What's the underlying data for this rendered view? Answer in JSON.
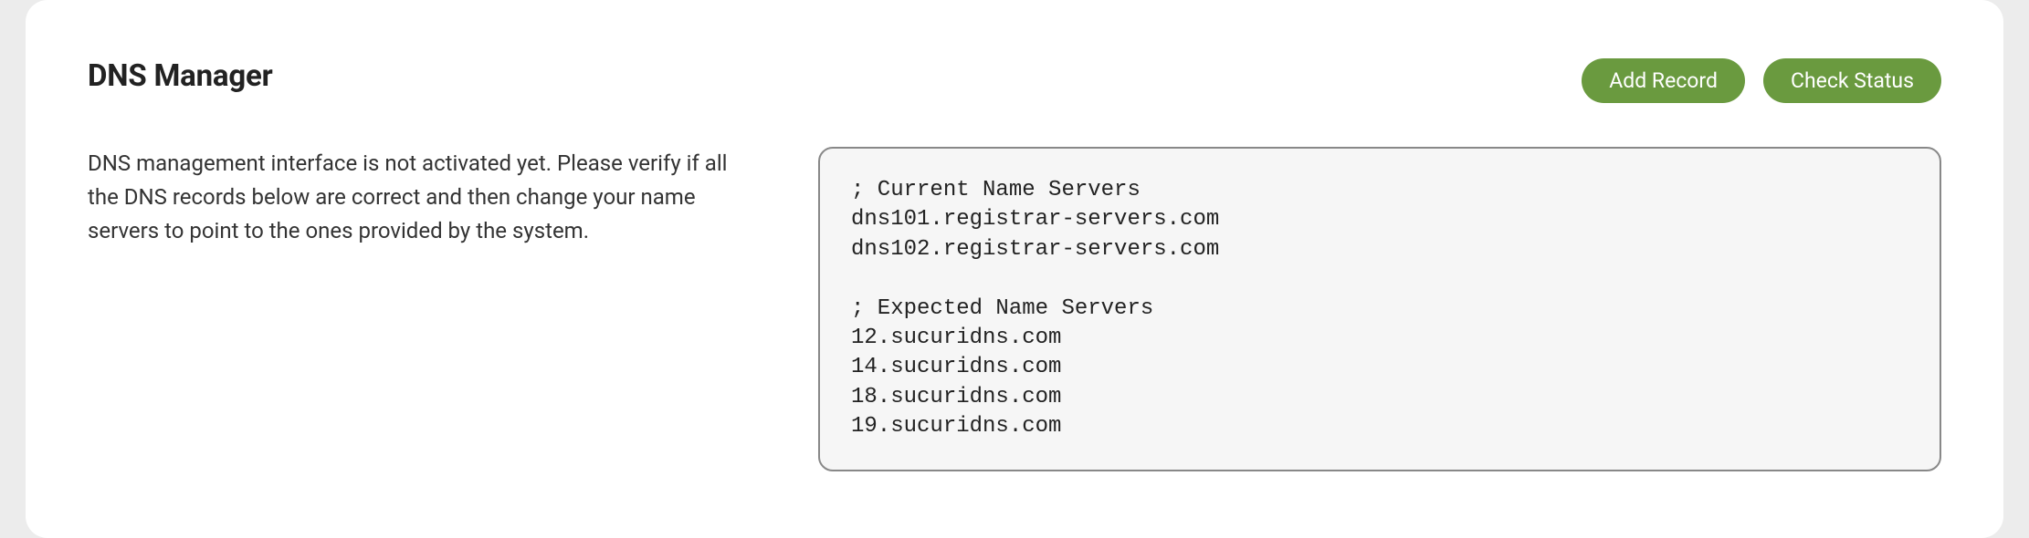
{
  "header": {
    "title": "DNS Manager",
    "buttons": {
      "add_record": "Add Record",
      "check_status": "Check Status"
    }
  },
  "main": {
    "description": "DNS management interface is not activated yet. Please verify if all the DNS records below are correct and then change your name servers to point to the ones provided by the system.",
    "code_block": "; Current Name Servers\ndns101.registrar-servers.com\ndns102.registrar-servers.com\n\n; Expected Name Servers\n12.sucuridns.com\n14.sucuridns.com\n18.sucuridns.com\n19.sucuridns.com"
  },
  "colors": {
    "button_bg": "#6a9a3f",
    "card_bg": "#ffffff",
    "page_bg": "#ececec",
    "code_bg": "#f6f6f6",
    "code_border": "#888888"
  }
}
